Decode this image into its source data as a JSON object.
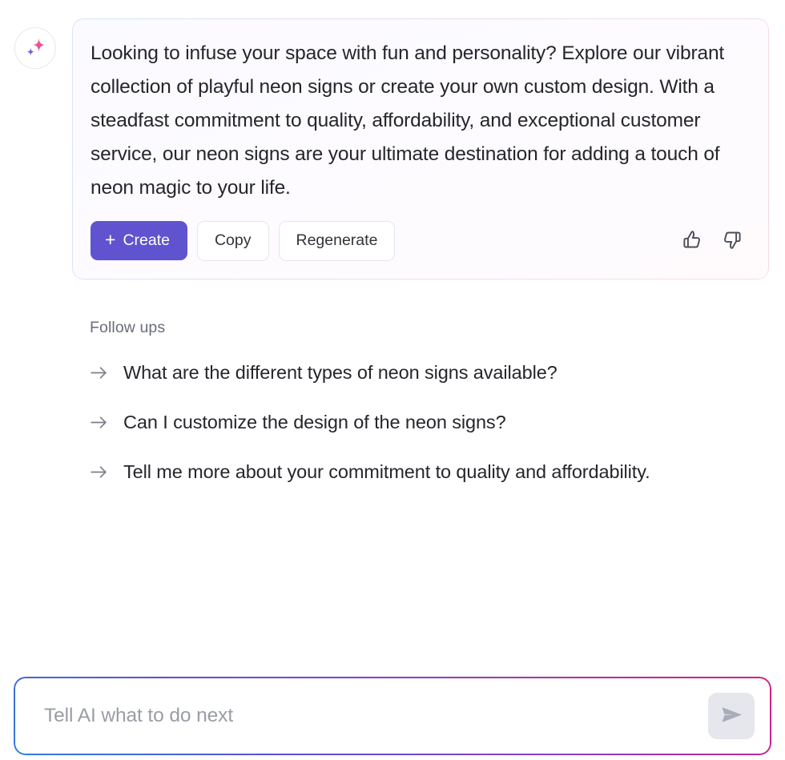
{
  "assistant": {
    "avatar_icon": "sparkles-icon",
    "avatar_colors": {
      "large_star_start": "#f8a14f",
      "large_star_end": "#d833b0",
      "small_star_start": "#4f7df8",
      "small_star_end": "#a93ad6"
    },
    "message": "Looking to infuse your space with fun and personality? Explore our vibrant collection of playful neon signs or create your own custom design. With a steadfast commitment to quality, affordability, and exceptional customer service, our neon signs are your ultimate destination for adding a touch of neon magic to your life.",
    "actions": {
      "create_label": "Create",
      "create_icon": "plus-icon",
      "create_color": "#6053CF",
      "copy_label": "Copy",
      "regenerate_label": "Regenerate",
      "thumbs_up_icon": "thumbs-up-icon",
      "thumbs_down_icon": "thumbs-down-icon"
    }
  },
  "followups": {
    "title": "Follow ups",
    "arrow_icon": "arrow-right-icon",
    "items": [
      {
        "text": "What are the different types of neon signs available?"
      },
      {
        "text": "Can I customize the design of the neon signs?"
      },
      {
        "text": "Tell me more about your commitment to quality and affordability."
      }
    ]
  },
  "composer": {
    "placeholder": "Tell AI what to do next",
    "value": "",
    "send_icon": "send-icon",
    "border_gradient": [
      "#2F7DE1",
      "#5B4ED6",
      "#8B3FC4",
      "#C2249C",
      "#D1227F"
    ]
  }
}
